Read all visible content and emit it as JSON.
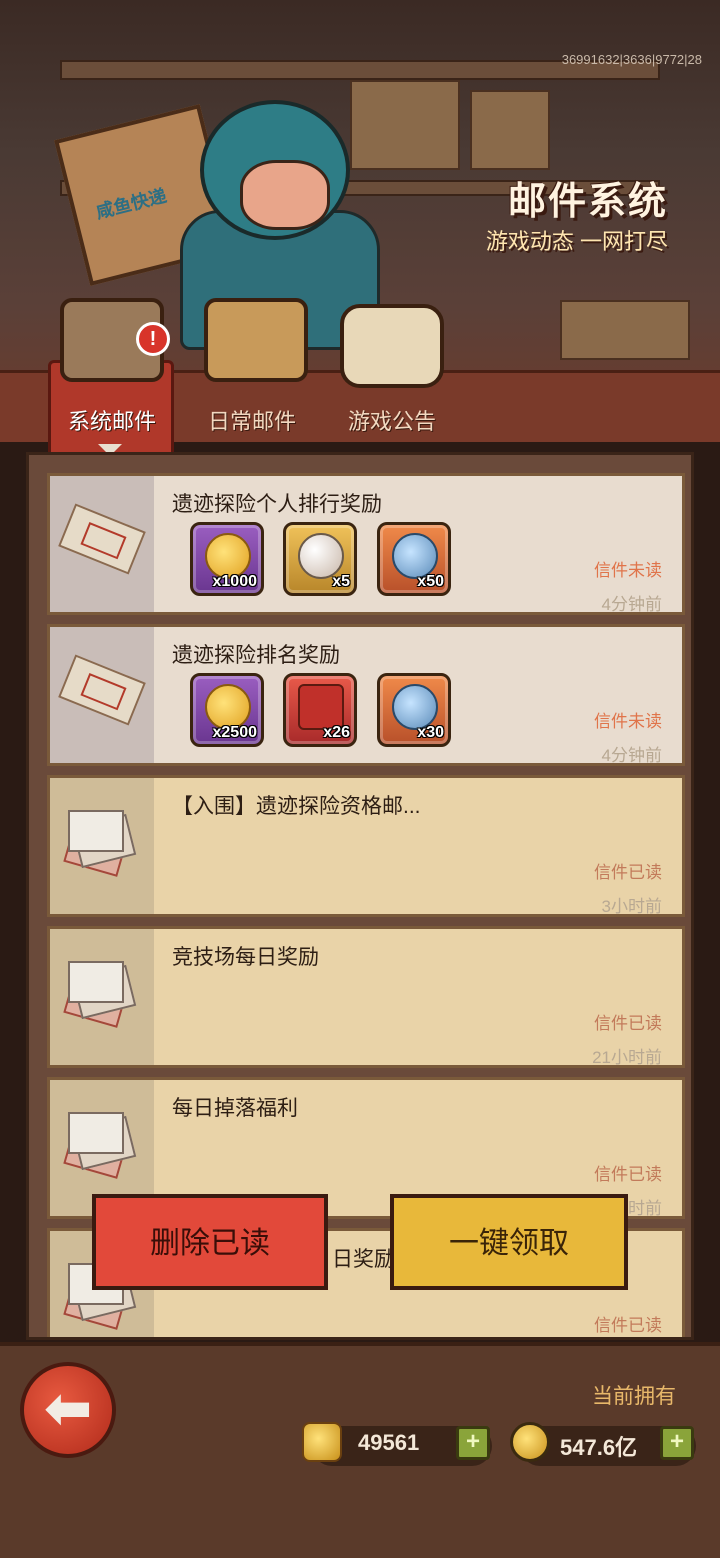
{
  "header": {
    "id_text": "36991632|3636|9772|28",
    "title": "邮件系统",
    "subtitle": "游戏动态 一网打尽",
    "box_label": "咸鱼快递"
  },
  "tabs": [
    {
      "label": "系统邮件",
      "active": true,
      "badge": "!"
    },
    {
      "label": "日常邮件",
      "active": false
    },
    {
      "label": "游戏公告",
      "active": false
    }
  ],
  "mails": [
    {
      "title": "遗迹探险个人排行奖励",
      "status": "信件未读",
      "time": "4分钟前",
      "items": [
        {
          "icon": "gold-fish-coin-icon",
          "count": "x1000"
        },
        {
          "icon": "pearl-icon",
          "count": "x5"
        },
        {
          "icon": "planet-orb-icon",
          "count": "x50"
        }
      ]
    },
    {
      "title": "遗迹探险排名奖励",
      "status": "信件未读",
      "time": "4分钟前",
      "items": [
        {
          "icon": "gold-fish-coin-icon",
          "count": "x2500"
        },
        {
          "icon": "red-chest-icon",
          "count": "x26"
        },
        {
          "icon": "planet-orb-icon",
          "count": "x30"
        }
      ]
    },
    {
      "title": "【入围】遗迹探险资格邮...",
      "status": "信件已读",
      "time": "3小时前"
    },
    {
      "title": "竞技场每日奖励",
      "status": "信件已读",
      "time": "21小时前"
    },
    {
      "title": "每日掉落福利",
      "status": "信件已读",
      "time": "21小时前"
    },
    {
      "title": "日奖励",
      "status": "信件已读",
      "time": ""
    }
  ],
  "buttons": {
    "delete_read": "删除已读",
    "claim_all": "一键领取"
  },
  "bottom": {
    "own_label": "当前拥有",
    "resource1_value": "49561",
    "resource2_value": "547.6亿",
    "back_glyph": "⬅"
  }
}
